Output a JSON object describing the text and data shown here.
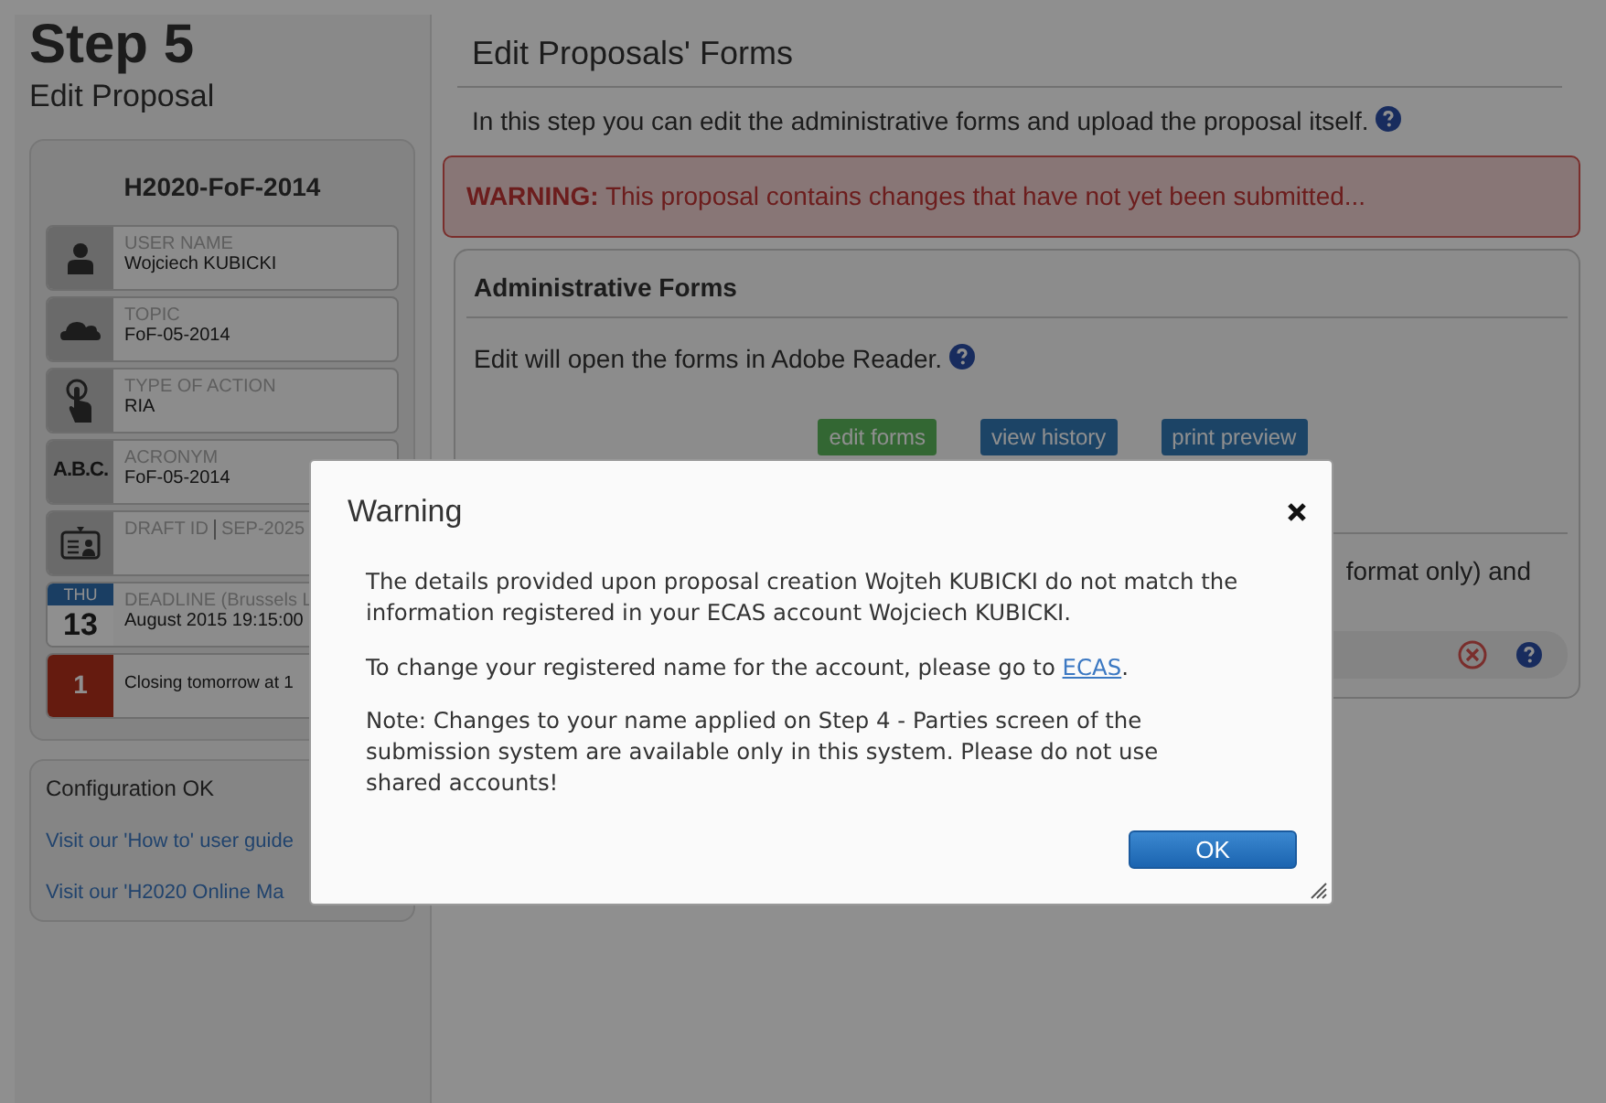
{
  "step": {
    "title": "Step 5",
    "subtitle": "Edit Proposal"
  },
  "sidebar": {
    "title": "H2020-FoF-2014",
    "items": [
      {
        "kind": "user",
        "label": "USER NAME",
        "value": "Wojciech KUBICKI"
      },
      {
        "kind": "topic",
        "label": "TOPIC",
        "value": "FoF-05-2014"
      },
      {
        "kind": "action",
        "label": "TYPE OF ACTION",
        "value": "RIA"
      },
      {
        "kind": "acronym",
        "icon_text": "A.B.C.",
        "label": "ACRONYM",
        "value": "FoF-05-2014"
      },
      {
        "kind": "draft",
        "label": "DRAFT ID",
        "value": "SEP-2025"
      },
      {
        "kind": "deadline",
        "day": "THU",
        "date": "13",
        "label": "DEADLINE (Brussels L",
        "value": "August 2015 19:15:00"
      },
      {
        "kind": "countdown",
        "icon_text": "1",
        "value": "Closing tomorrow at 1"
      }
    ]
  },
  "config": {
    "status": "Configuration OK",
    "links": [
      "Visit our 'How to' user guide",
      "Visit our 'H2020 Online Ma"
    ]
  },
  "main": {
    "title": "Edit Proposals' Forms",
    "intro": "In this step you can edit the administrative forms and upload the proposal itself.",
    "alert": "**WARNING:** This proposal contains changes that have not yet been submitted...",
    "admin_forms": {
      "title": "Administrative Forms",
      "note": "Edit will open the forms in Adobe Reader.",
      "buttons": [
        {
          "label": "edit forms",
          "kind": "success"
        },
        {
          "label": "view history",
          "kind": "primary"
        },
        {
          "label": "print preview",
          "kind": "primary"
        }
      ]
    },
    "upload": {
      "text": "format only) and"
    }
  },
  "modal": {
    "title": "Warning",
    "paragraphs": [
      {
        "text": "The details provided upon proposal creation Wojteh KUBICKI do not match the information registered in your ECAS account Wojciech KUBICKI."
      },
      {
        "text": "To change your registered name for the account, please go to ",
        "link": "ECAS",
        "after": "."
      },
      {
        "text": "Note: Changes to your name applied on Step 4 - Parties screen of the submission system are available only in this system. Please do not use shared accounts!"
      }
    ],
    "buttons": [
      "OK"
    ]
  }
}
